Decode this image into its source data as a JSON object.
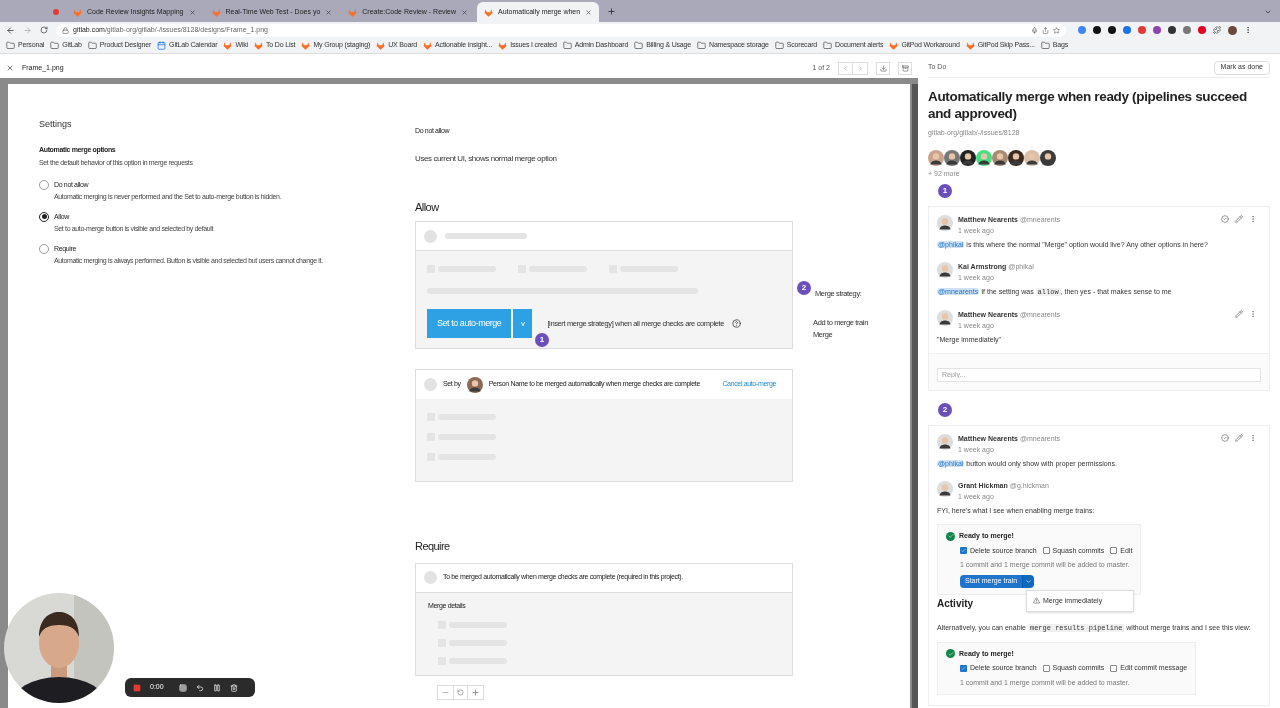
{
  "browser": {
    "tabs": [
      {
        "title": "Code Review Insights Mapping",
        "selected": false
      },
      {
        "title": "Real-Time Web Test - Does yo",
        "selected": false
      },
      {
        "title": "Create:Code Review - Review",
        "selected": false
      },
      {
        "title": "Automatically merge when",
        "selected": true
      }
    ],
    "url_host": "gitlab.com",
    "url_path": "/gitlab-org/gitlab/-/issues/8128/designs/Frame_1.png",
    "bookmarks": [
      {
        "label": "Personal",
        "kind": "folder"
      },
      {
        "label": "GitLab",
        "kind": "folder"
      },
      {
        "label": "Product Designer",
        "kind": "folder"
      },
      {
        "label": "GitLab Calendar",
        "kind": "calendar"
      },
      {
        "label": "Wiki",
        "kind": "gitlab"
      },
      {
        "label": "To Do List",
        "kind": "gitlab"
      },
      {
        "label": "My Group (staging)",
        "kind": "gitlab"
      },
      {
        "label": "UX Board",
        "kind": "gitlab"
      },
      {
        "label": "Actionable insight...",
        "kind": "gitlab"
      },
      {
        "label": "Issues I created",
        "kind": "gitlab"
      },
      {
        "label": "Admin Dashboard",
        "kind": "folder"
      },
      {
        "label": "Billing & Usage",
        "kind": "folder"
      },
      {
        "label": "Namespace storage",
        "kind": "folder"
      },
      {
        "label": "Scorecard",
        "kind": "folder"
      },
      {
        "label": "Document alerts",
        "kind": "folder"
      },
      {
        "label": "GitPod Workaround",
        "kind": "gitlab"
      },
      {
        "label": "GitPod Skip Pass...",
        "kind": "gitlab"
      },
      {
        "label": "Bags",
        "kind": "folder"
      }
    ]
  },
  "design_bar": {
    "file": "Frame_1.png",
    "pager": "1 of 2"
  },
  "frame": {
    "settings": {
      "title": "Settings",
      "heading": "Automatic merge options",
      "hint": "Set the default behavior of this option in merge requests",
      "options": [
        {
          "label": "Do not allow",
          "description": "Automatic merging is never performed and the Set to auto-merge button is hidden.",
          "selected": false
        },
        {
          "label": "Allow",
          "description": "Set to auto-merge button is visible and selected by default",
          "selected": true
        },
        {
          "label": "Require",
          "description": "Automatic merging is always performed. Button is visible and selected but users cannot change it.",
          "selected": false
        }
      ]
    },
    "do_not_allow": {
      "label": "Do not allow",
      "text": "Uses current UI, shows normal merge option"
    },
    "allow": {
      "title": "Allow",
      "button": "Set to auto-merge",
      "caret": "v",
      "strategy_text": "[insert merge strategy] when all merge checks are complete",
      "pin": "1",
      "side_pin": "2",
      "side_heading": "Merge strategy:",
      "side_options": [
        "Add to merge train",
        "Merge"
      ]
    },
    "set_by": {
      "prefix": "Set by",
      "text": "Person Name to be merged automatically when merge checks are complete",
      "link": "Cancel auto-merge"
    },
    "require": {
      "title": "Require",
      "text": "To be merged automatically when merge checks are complete (required in this project).",
      "details": "Merge details"
    }
  },
  "issue": {
    "status": "To Do",
    "action": "Mark as done",
    "title": "Automatically merge when ready (pipelines succeed and approved)",
    "ref": "gitlab-org/gitlab/-/issues/8128",
    "more": "+ 92 more",
    "threads": [
      {
        "pin": "1",
        "reply_placeholder": "Reply...",
        "notes": [
          {
            "author": "Matthew Nearents",
            "handle": "@mnearents",
            "time": "1 week ago",
            "resolvable": true,
            "editable": true,
            "blocks": [
              {
                "kind": "text",
                "segs": [
                  {
                    "kind": "mention",
                    "text": "@phikal"
                  },
                  {
                    "kind": "text",
                    "text": " is this where the normal \"Merge\" option would live? Any other options in here?"
                  }
                ]
              }
            ]
          },
          {
            "author": "Kai Armstrong",
            "handle": "@phikal",
            "time": "1 week ago",
            "resolvable": false,
            "editable": false,
            "blocks": [
              {
                "kind": "text",
                "segs": [
                  {
                    "kind": "mention",
                    "text": "@mnearents"
                  },
                  {
                    "kind": "text",
                    "text": " If the setting was "
                  },
                  {
                    "kind": "code",
                    "text": "allow"
                  },
                  {
                    "kind": "text",
                    "text": ", then yes - that makes sense to me"
                  }
                ]
              }
            ]
          },
          {
            "author": "Matthew Nearents",
            "handle": "@mnearents",
            "time": "1 week ago",
            "resolvable": false,
            "editable": true,
            "blocks": [
              {
                "kind": "text",
                "segs": [
                  {
                    "kind": "text",
                    "text": "\"Merge immediately\""
                  }
                ]
              }
            ]
          }
        ]
      },
      {
        "pin": "2",
        "notes": [
          {
            "author": "Matthew Nearents",
            "handle": "@mnearents",
            "time": "1 week ago",
            "resolvable": true,
            "editable": true,
            "blocks": [
              {
                "kind": "text",
                "segs": [
                  {
                    "kind": "mention",
                    "text": "@phikal"
                  },
                  {
                    "kind": "text",
                    "text": " button would only show with proper permissions."
                  }
                ]
              }
            ]
          },
          {
            "author": "Grant Hickman",
            "handle": "@g.hickman",
            "time": "1 week ago",
            "resolvable": false,
            "editable": false,
            "blocks": [
              {
                "kind": "text",
                "segs": [
                  {
                    "kind": "text",
                    "text": "FYI, here's what I see when enabling merge trains:"
                  }
                ]
              },
              {
                "kind": "widget",
                "status": "Ready to merge!",
                "options": [
                  {
                    "label": "Delete source branch",
                    "checked": true
                  },
                  {
                    "label": "Squash commits",
                    "checked": false
                  },
                  {
                    "label": "Edit",
                    "checked": false
                  }
                ],
                "info": "1 commit and 1 merge commit will be added to master.",
                "button": "Start merge train",
                "menu_item": "Merge immediately"
              },
              {
                "kind": "heading",
                "text": "Activity"
              },
              {
                "kind": "text",
                "segs": [
                  {
                    "kind": "text",
                    "text": "Alternatively, you can enable "
                  },
                  {
                    "kind": "code",
                    "text": "merge results pipeline"
                  },
                  {
                    "kind": "text",
                    "text": " without merge trains and I see this view:"
                  }
                ]
              },
              {
                "kind": "widget",
                "status": "Ready to merge!",
                "options": [
                  {
                    "label": "Delete source branch",
                    "checked": true
                  },
                  {
                    "label": "Squash commits",
                    "checked": false
                  },
                  {
                    "label": "Edit commit message",
                    "checked": false
                  }
                ],
                "info": "1 commit and 1 merge commit will be added to master."
              }
            ]
          }
        ]
      }
    ]
  },
  "recorder": {
    "time": "0:00"
  }
}
